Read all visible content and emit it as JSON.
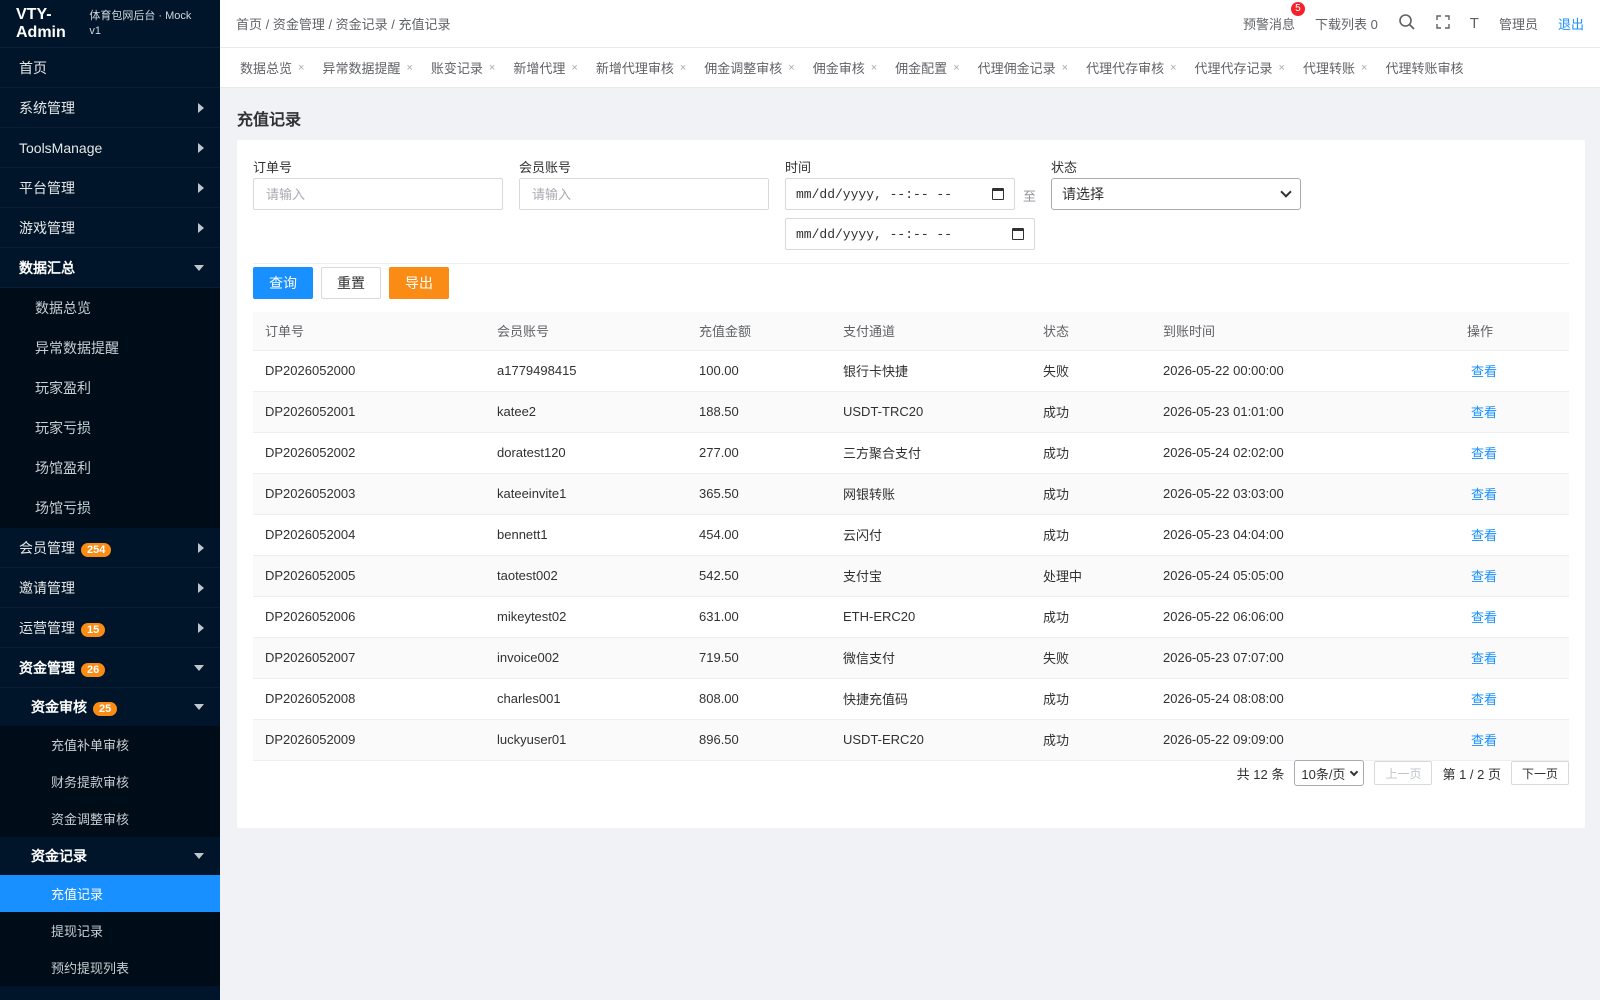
{
  "app": {
    "title": "VTY-Admin",
    "subtitle": "体育包网后台 · Mock v1"
  },
  "header": {
    "breadcrumb": "首页 / 资金管理 / 资金记录 / 充值记录",
    "alerts_label": "预警消息",
    "alerts_count": "5",
    "downloads_label": "下载列表 0",
    "font_icon_label": "T",
    "user_label": "管理员",
    "logout_label": "退出"
  },
  "sidebar": {
    "top": [
      {
        "label": "首页"
      },
      {
        "label": "系统管理"
      },
      {
        "label": "ToolsManage"
      },
      {
        "label": "平台管理"
      },
      {
        "label": "游戏管理"
      }
    ],
    "data_summary": {
      "label": "数据汇总",
      "children": [
        "数据总览",
        "异常数据提醒",
        "玩家盈利",
        "玩家亏损",
        "场馆盈利",
        "场馆亏损"
      ]
    },
    "member": {
      "label": "会员管理",
      "badge": "254"
    },
    "invite": {
      "label": "邀请管理"
    },
    "ops": {
      "label": "运营管理",
      "badge": "15"
    },
    "funds": {
      "label": "资金管理",
      "badge": "26",
      "audit": {
        "label": "资金审核",
        "badge": "25",
        "children": [
          "充值补单审核",
          "财务提款审核",
          "资金调整审核"
        ]
      },
      "records": {
        "label": "资金记录",
        "children": [
          "充值记录",
          "提现记录",
          "预约提现列表"
        ]
      }
    }
  },
  "tabs": [
    "数据总览",
    "异常数据提醒",
    "账变记录",
    "新增代理",
    "新增代理审核",
    "佣金调整审核",
    "佣金审核",
    "佣金配置",
    "代理佣金记录",
    "代理代存审核",
    "代理代存记录",
    "代理转账",
    "代理转账审核"
  ],
  "page": {
    "title": "充值记录"
  },
  "filters": {
    "order_label": "订单号",
    "order_placeholder": "请输入",
    "member_label": "会员账号",
    "member_placeholder": "请输入",
    "time_label": "时间",
    "time_start": "mm/dd/yyyy, --:-- --",
    "time_end": "mm/dd/yyyy, --:-- --",
    "to_label": "至",
    "status_label": "状态",
    "status_value": "请选择"
  },
  "actions": {
    "query": "查询",
    "reset": "重置",
    "export": "导出"
  },
  "table": {
    "columns": [
      "订单号",
      "会员账号",
      "充值金额",
      "支付通道",
      "状态",
      "到账时间",
      "操作"
    ],
    "action_label": "查看",
    "rows": [
      [
        "DP2026052000",
        "a1779498415",
        "100.00",
        "银行卡快捷",
        "失败",
        "2026-05-22 00:00:00"
      ],
      [
        "DP2026052001",
        "katee2",
        "188.50",
        "USDT-TRC20",
        "成功",
        "2026-05-23 01:01:00"
      ],
      [
        "DP2026052002",
        "doratest120",
        "277.00",
        "三方聚合支付",
        "成功",
        "2026-05-24 02:02:00"
      ],
      [
        "DP2026052003",
        "kateeinvite1",
        "365.50",
        "网银转账",
        "成功",
        "2026-05-22 03:03:00"
      ],
      [
        "DP2026052004",
        "bennett1",
        "454.00",
        "云闪付",
        "成功",
        "2026-05-23 04:04:00"
      ],
      [
        "DP2026052005",
        "taotest002",
        "542.50",
        "支付宝",
        "处理中",
        "2026-05-24 05:05:00"
      ],
      [
        "DP2026052006",
        "mikeytest02",
        "631.00",
        "ETH-ERC20",
        "成功",
        "2026-05-22 06:06:00"
      ],
      [
        "DP2026052007",
        "invoice002",
        "719.50",
        "微信支付",
        "失败",
        "2026-05-23 07:07:00"
      ],
      [
        "DP2026052008",
        "charles001",
        "808.00",
        "快捷充值码",
        "成功",
        "2026-05-24 08:08:00"
      ],
      [
        "DP2026052009",
        "luckyuser01",
        "896.50",
        "USDT-ERC20",
        "成功",
        "2026-05-22 09:09:00"
      ]
    ]
  },
  "pagination": {
    "total": "共 12 条",
    "page_size": "10条/页",
    "prev": "上一页",
    "page_info": "第 1 / 2 页",
    "next": "下一页"
  }
}
